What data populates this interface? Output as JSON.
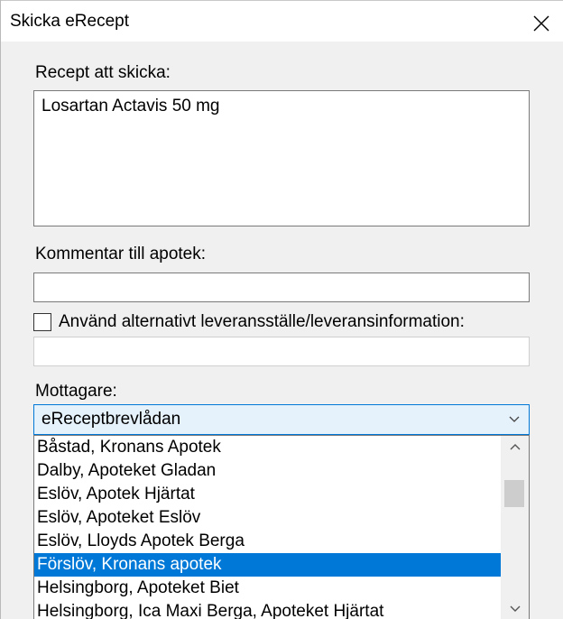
{
  "dialog": {
    "title": "Skicka eRecept",
    "close_icon": "close-icon"
  },
  "prescriptions": {
    "label": "Recept att skicka:",
    "value": "Losartan Actavis 50 mg"
  },
  "comment": {
    "label": "Kommentar till apotek:",
    "value": ""
  },
  "alternative_delivery": {
    "checked": false,
    "label": "Använd alternativt leveransställe/leveransinformation:",
    "value": ""
  },
  "recipient": {
    "label": "Mottagare:",
    "selected": "eReceptbrevlådan",
    "arrow_icon": "chevron-down-icon",
    "options": [
      "Båstad, Kronans Apotek",
      "Dalby, Apoteket Gladan",
      "Eslöv, Apotek Hjärtat",
      "Eslöv, Apoteket Eslöv",
      "Eslöv, Lloyds Apotek Berga",
      "Förslöv, Kronans apotek",
      "Helsingborg, Apoteket Biet",
      "Helsingborg, Ica Maxi Berga, Apoteket Hjärtat"
    ],
    "highlighted_index": 5
  },
  "colors": {
    "selection": "#0078d7",
    "combo_background": "#e5f1fb",
    "dialog_background": "#f0f0f0"
  }
}
